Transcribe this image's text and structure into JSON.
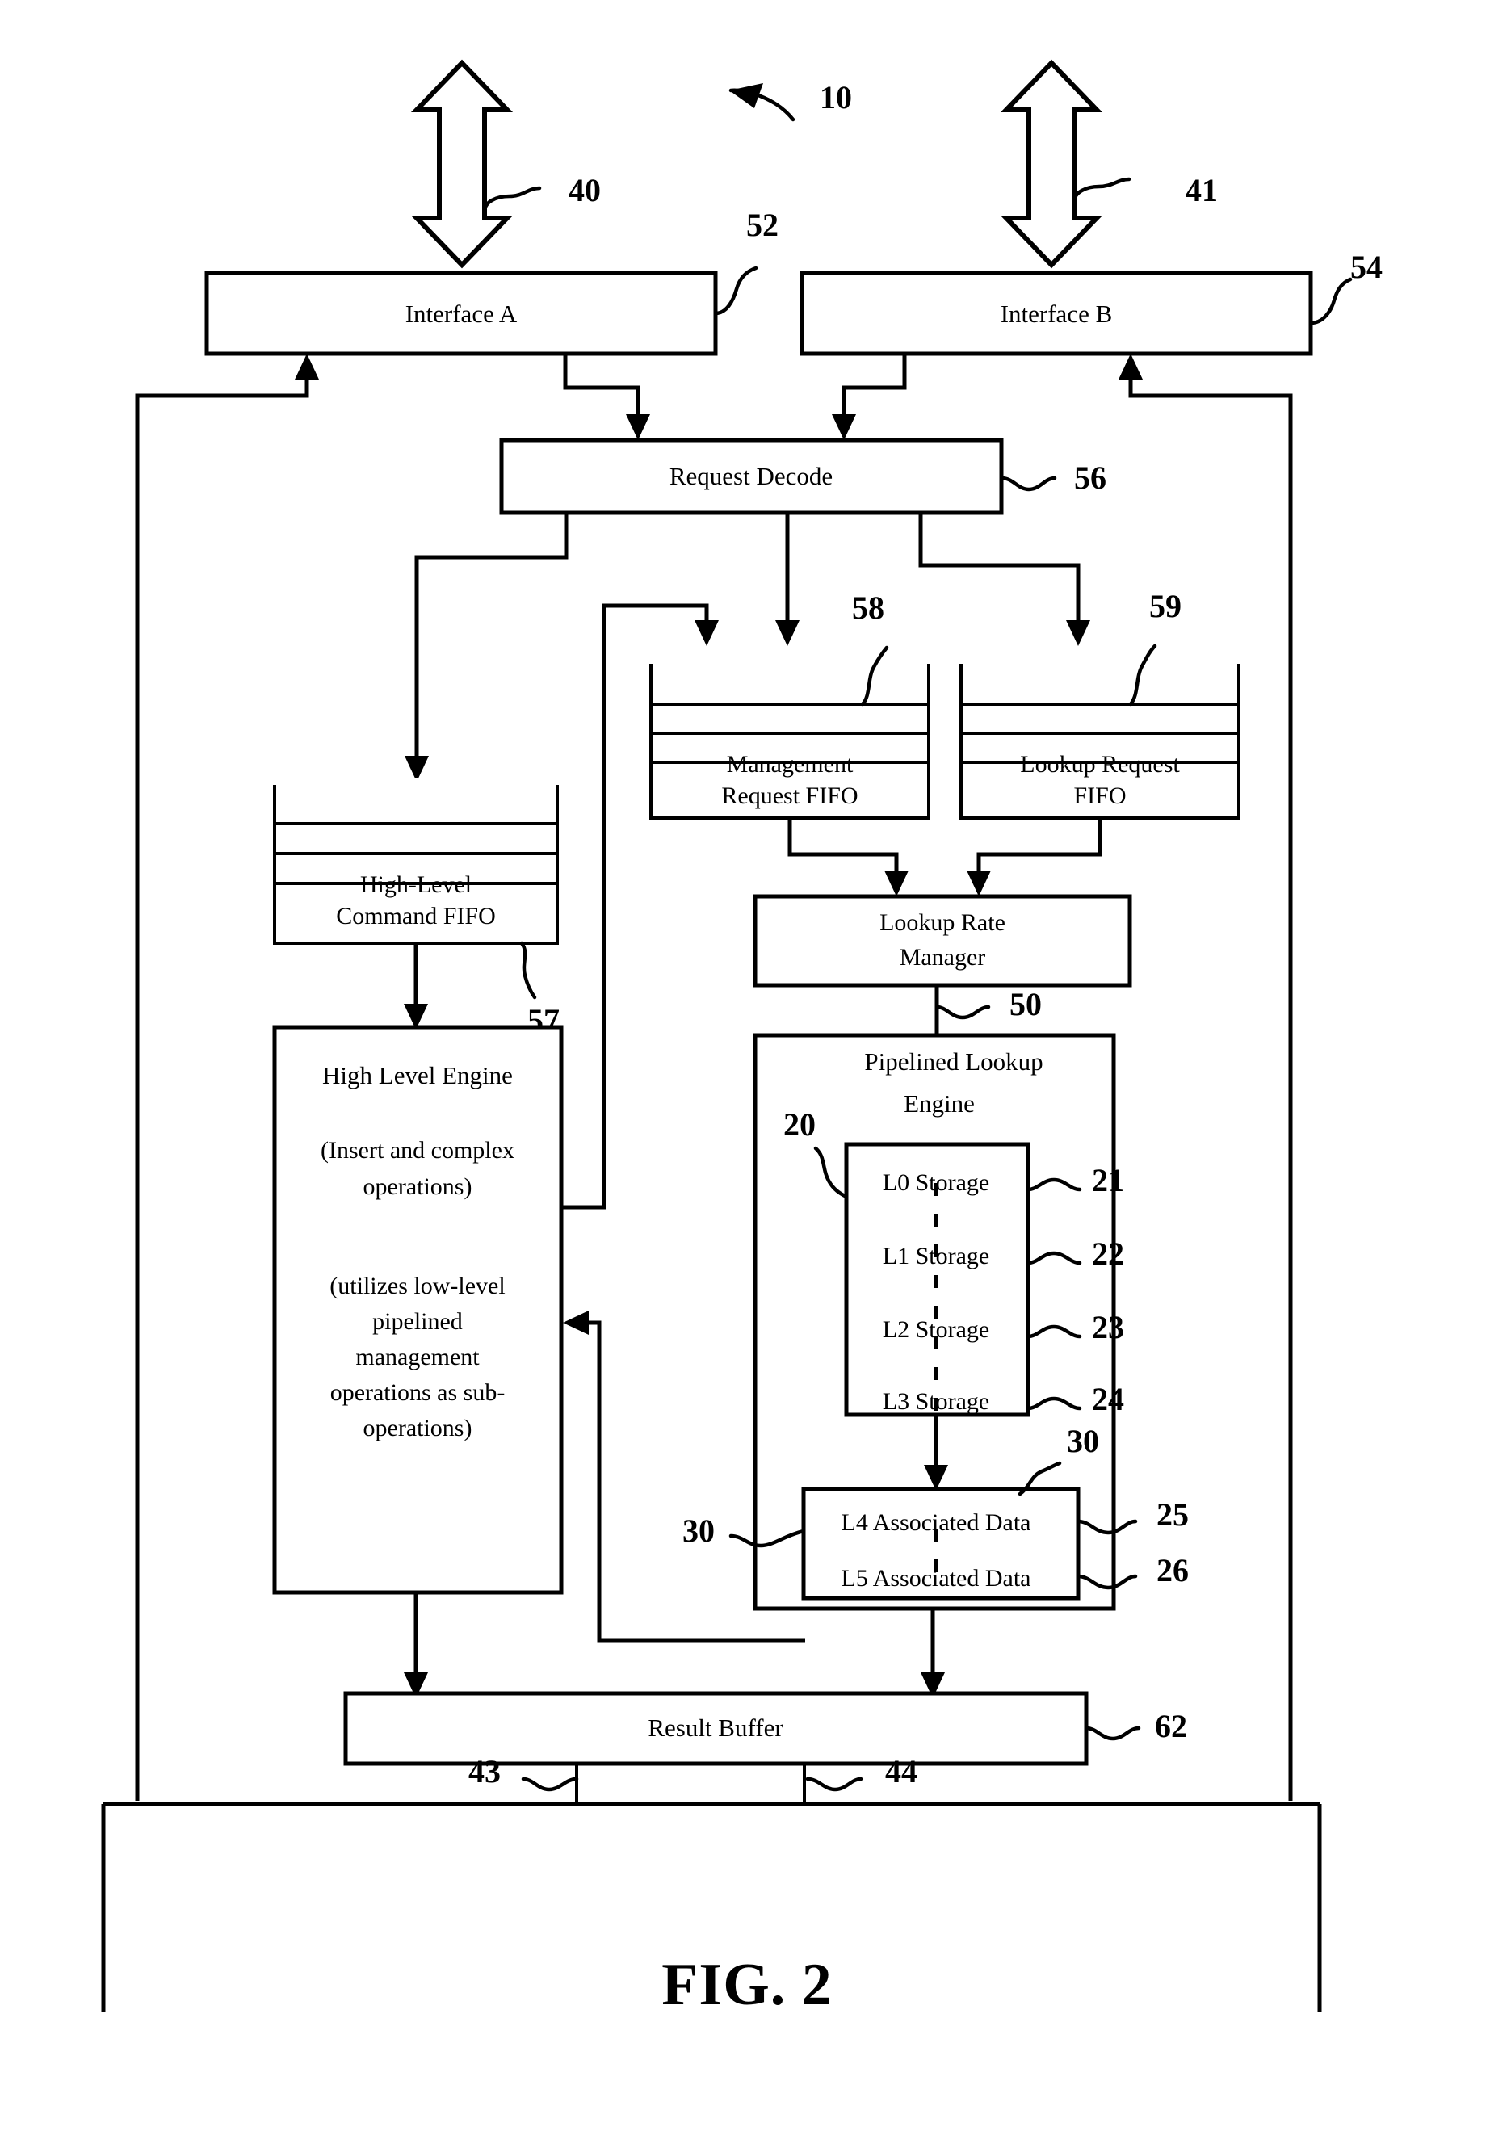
{
  "figure": {
    "caption": "FIG. 2",
    "system_ref": "10"
  },
  "blocks": {
    "interface_a": {
      "label": "Interface A",
      "ref": "52"
    },
    "interface_b": {
      "label": "Interface B",
      "ref": "54"
    },
    "request_decode": {
      "label": "Request Decode",
      "ref": "56"
    },
    "management_request_fifo": {
      "label_line1": "Management",
      "label_line2": "Request FIFO",
      "ref": "58"
    },
    "lookup_request_fifo": {
      "label_line1": "Lookup Request",
      "label_line2": "FIFO",
      "ref": "59"
    },
    "high_level_command_fifo": {
      "label_line1": "High-Level",
      "label_line2": "Command FIFO",
      "ref": "57"
    },
    "lookup_rate_manager": {
      "label_line1": "Lookup Rate",
      "label_line2": "Manager",
      "ref": "50"
    },
    "high_level_engine": {
      "title": "High Level Engine",
      "note1_line1": "(Insert and  complex",
      "note1_line2": "operations)",
      "note2_line1": "(utilizes low-level",
      "note2_line2": "pipelined",
      "note2_line3": "management",
      "note2_line4": "operations as sub-",
      "note2_line5": "operations)"
    },
    "pipelined_lookup_engine": {
      "title_line1": "Pipelined Lookup",
      "title_line2": "Engine",
      "ref": "20"
    },
    "storage": {
      "ref": "20",
      "levels": [
        {
          "label": "L0 Storage",
          "ref": "21"
        },
        {
          "label": "L1 Storage",
          "ref": "22"
        },
        {
          "label": "L2 Storage",
          "ref": "23"
        },
        {
          "label": "L3 Storage",
          "ref": "24"
        }
      ]
    },
    "associated_data": {
      "ref_left": "30",
      "ref_top": "30",
      "levels": [
        {
          "label": "L4 Associated Data",
          "ref": "25"
        },
        {
          "label": "L5 Associated Data",
          "ref": "26"
        }
      ]
    },
    "result_buffer": {
      "label": "Result Buffer",
      "ref": "62"
    }
  },
  "connections": {
    "bus_a": {
      "ref": "40"
    },
    "bus_b": {
      "ref": "41"
    },
    "result_out_a": {
      "ref": "43"
    },
    "result_out_b": {
      "ref": "44"
    }
  }
}
